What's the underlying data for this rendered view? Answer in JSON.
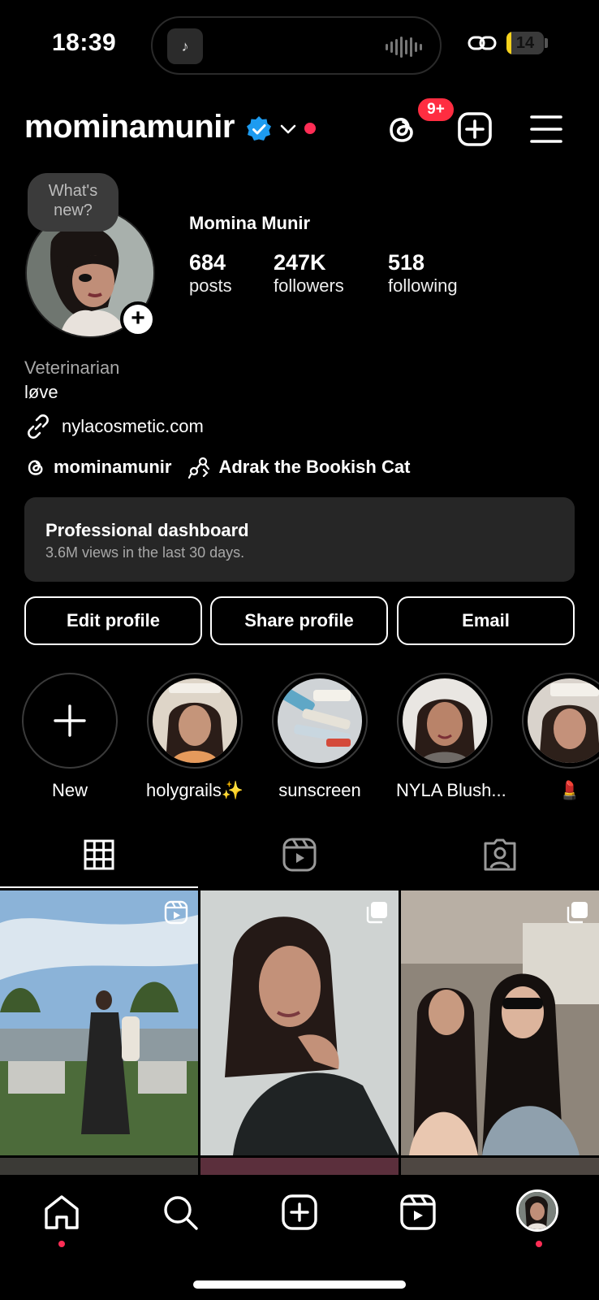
{
  "status_bar": {
    "time": "18:39",
    "battery": "14",
    "battery_fraction": 0.14,
    "battery_color": "#f7d21c"
  },
  "header": {
    "username": "mominamunir",
    "threads_badge": "9+"
  },
  "profile": {
    "note": "What's new?",
    "full_name": "Momina Munir",
    "stats": [
      {
        "value": "684",
        "label": "posts"
      },
      {
        "value": "247K",
        "label": "followers"
      },
      {
        "value": "518",
        "label": "following"
      }
    ],
    "category": "Veterinarian",
    "bio": "løve",
    "link": "nylacosmetic.com",
    "threads_handle": "mominamunir",
    "linked_profile": "Adrak the Bookish Cat"
  },
  "dashboard": {
    "title": "Professional dashboard",
    "subtitle": "3.6M views in the last 30 days."
  },
  "actions": {
    "edit": "Edit profile",
    "share": "Share profile",
    "email": "Email"
  },
  "highlights": [
    {
      "label": "New"
    },
    {
      "label": "holygrails✨"
    },
    {
      "label": "sunscreen"
    },
    {
      "label": "NYLA Blush..."
    },
    {
      "label": "💄"
    }
  ],
  "tabs": [
    "grid-icon",
    "reels-icon",
    "tagged-icon"
  ],
  "nav": [
    "home-icon",
    "search-icon",
    "create-icon",
    "reels-icon",
    "profile-avatar"
  ],
  "colors": {
    "accent_red": "#ff2d55",
    "verified_blue": "#1d9bf0",
    "dashboard_bg": "#262626"
  }
}
